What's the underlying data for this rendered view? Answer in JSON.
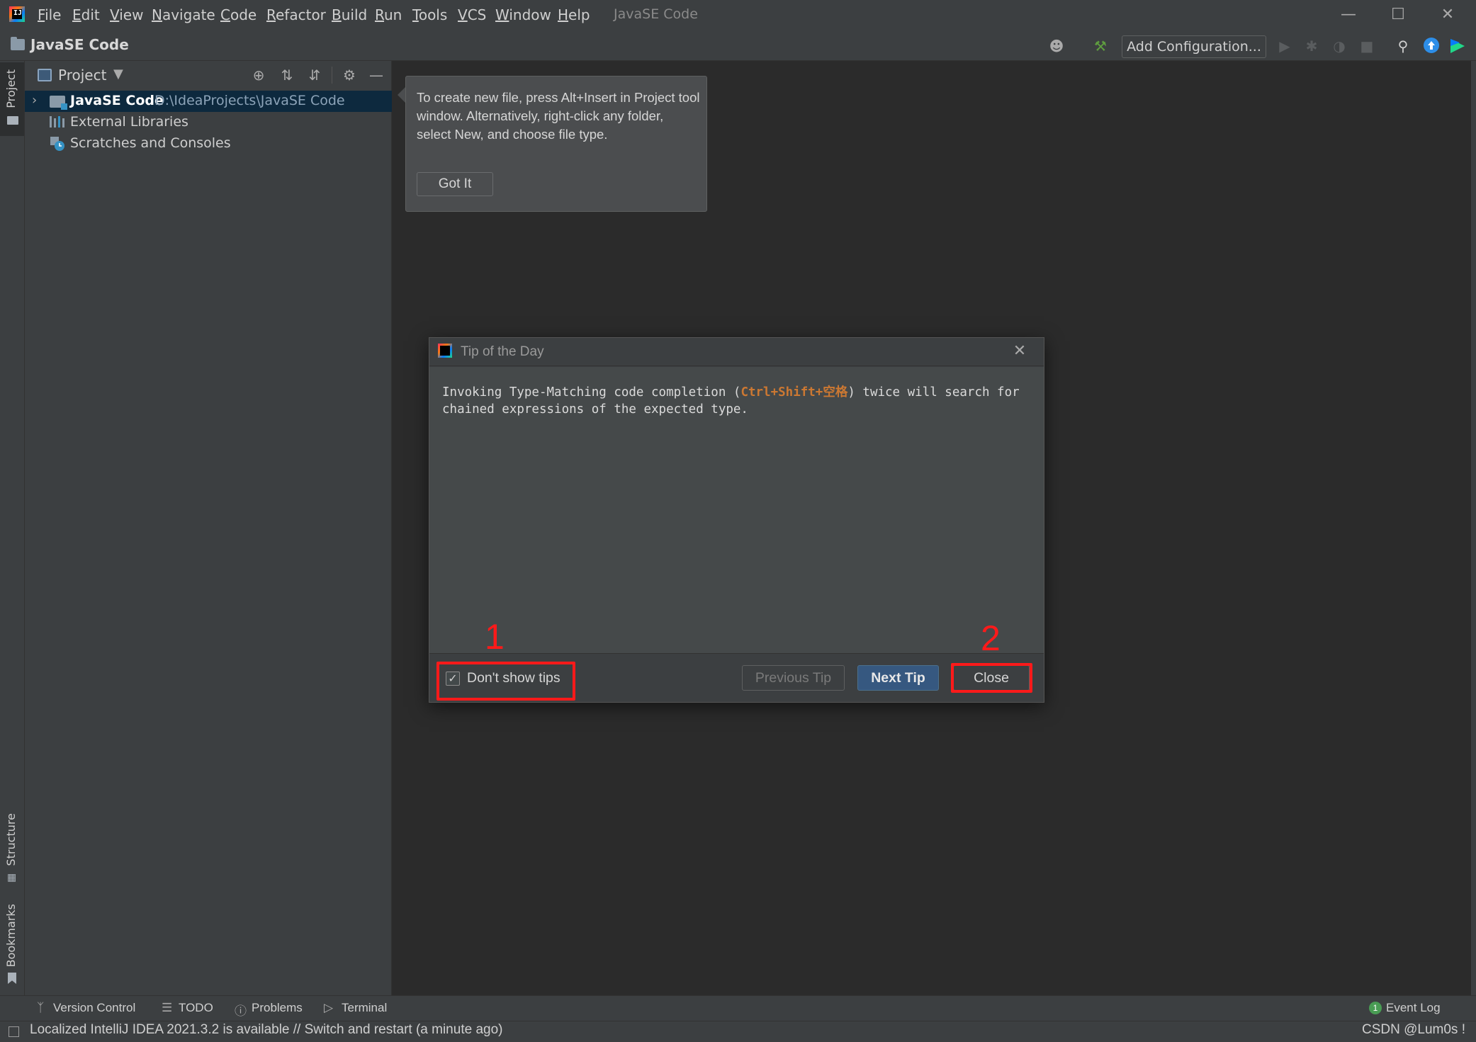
{
  "menubar": {
    "items": [
      "File",
      "Edit",
      "View",
      "Navigate",
      "Code",
      "Refactor",
      "Build",
      "Run",
      "Tools",
      "VCS",
      "Window",
      "Help"
    ],
    "window_title": "JavaSE Code"
  },
  "navbar": {
    "breadcrumb": "JavaSE Code",
    "add_configuration": "Add Configuration..."
  },
  "side_tabs": {
    "project": "Project",
    "structure": "Structure",
    "bookmarks": "Bookmarks"
  },
  "project_panel": {
    "title": "Project",
    "tree": [
      {
        "label": "JavaSE Code",
        "path": "D:\\IdeaProjects\\JavaSE Code"
      },
      {
        "label": "External Libraries"
      },
      {
        "label": "Scratches and Consoles"
      }
    ]
  },
  "hint_popup": {
    "text": "To create new file, press Alt+Insert in Project tool window. Alternatively, right-click any folder, select New, and choose file type.",
    "button": "Got It"
  },
  "tip_dialog": {
    "title": "Tip of the Day",
    "text_before": "Invoking Type-Matching code completion (",
    "shortcut": "Ctrl+Shift+空格",
    "text_after": ") twice will search for chained expressions of the expected type.",
    "checkbox_label": "Don't show tips",
    "checkbox_checked": true,
    "previous_button": "Previous Tip",
    "next_button": "Next Tip",
    "close_button": "Close"
  },
  "annotations": {
    "marker1": "1",
    "marker2": "2",
    "color": "#ff1a1a"
  },
  "bottom_tools": {
    "version_control": "Version Control",
    "todo": "TODO",
    "problems": "Problems",
    "terminal": "Terminal",
    "event_log": "Event Log",
    "event_count": "1"
  },
  "status_bar": {
    "message": "Localized IntelliJ IDEA 2021.3.2 is available // Switch and restart (a minute ago)",
    "watermark": "CSDN @Lum0s !"
  },
  "colors": {
    "background": "#2b2b2b",
    "panel": "#3c3f41",
    "selection": "#0d293e",
    "primary_button": "#365880",
    "shortcut": "#cc7832"
  }
}
